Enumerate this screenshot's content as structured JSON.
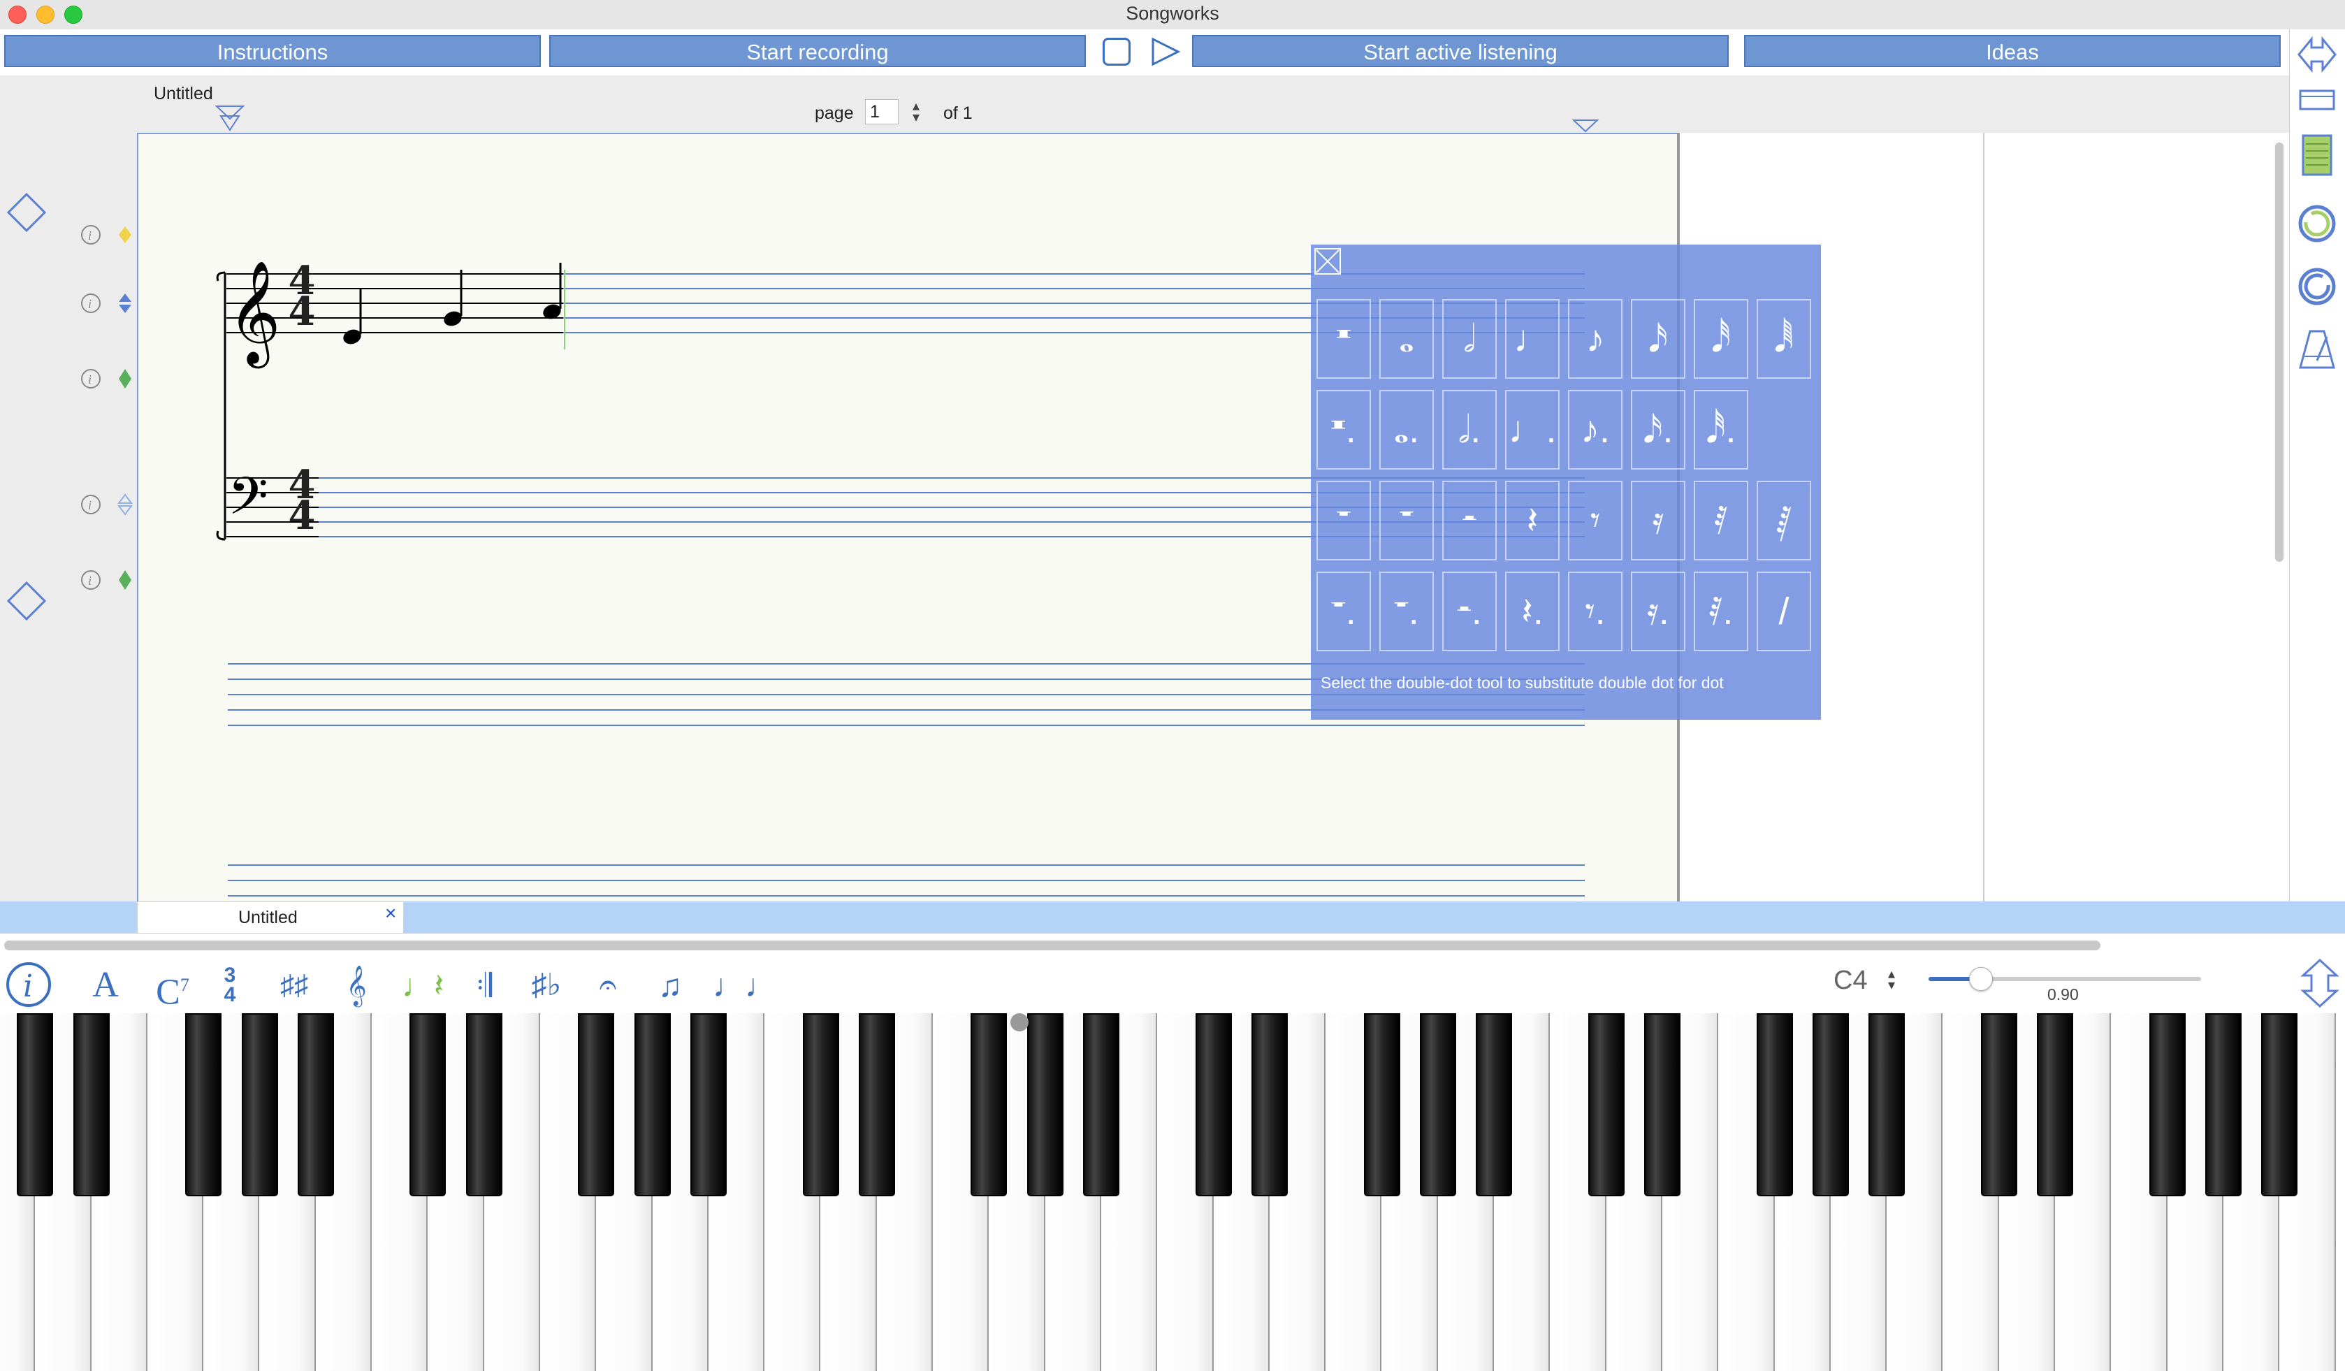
{
  "window": {
    "title": "Songworks"
  },
  "toolbar": {
    "instructions": "Instructions",
    "start_recording": "Start recording",
    "start_active_listening": "Start active listening",
    "ideas": "Ideas"
  },
  "score": {
    "title": "Untitled",
    "page_label": "page",
    "page_value": "1",
    "page_of": "of 1",
    "time_signature_top": "4",
    "time_signature_bottom": "4"
  },
  "palette": {
    "hint": "Select the double-dot tool to substitute double dot for dot"
  },
  "tabs": [
    {
      "label": "Untitled",
      "close": "×"
    }
  ],
  "bottom_toolbar": {
    "pitch_value": "C4",
    "slider_value": "0.90",
    "slider_fraction": 0.19,
    "icons": [
      "info-icon",
      "text-icon",
      "chord-icon",
      "time-signature-icon",
      "key-signature-icon",
      "clef-icon",
      "note-rest-icon",
      "barline-icon",
      "accidentals-icon",
      "fermata-icon",
      "beam-icon",
      "tie-icon"
    ]
  },
  "colors": {
    "accent": "#6e96d2",
    "palette_bg": "#6688de",
    "staff_line": "#5b7fd1",
    "highlight": "#b5d3f7"
  }
}
